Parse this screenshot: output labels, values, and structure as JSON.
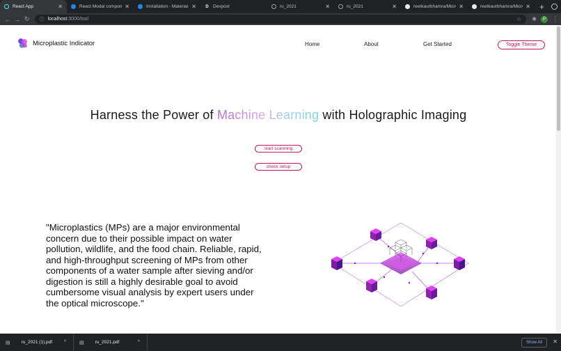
{
  "browser": {
    "tabs": [
      {
        "title": "React App",
        "active": true,
        "icon": "react-icon"
      },
      {
        "title": "React Modal component",
        "active": false,
        "icon": "mui-icon"
      },
      {
        "title": "Installation - Material-UI",
        "active": false,
        "icon": "mui-icon"
      },
      {
        "title": "Devpost",
        "active": false,
        "icon": "devpost-icon"
      },
      {
        "title": "ru_2021",
        "active": false,
        "icon": "globe-icon"
      },
      {
        "title": "ru_2021",
        "active": false,
        "icon": "globe-icon"
      },
      {
        "title": "reetkaurbhamra/Micropl",
        "active": false,
        "icon": "github-icon"
      },
      {
        "title": "reetkaurbhamra/Micropl",
        "active": false,
        "icon": "github-icon"
      }
    ],
    "url_host": "localhost",
    "url_path": ":3000/tool",
    "avatar_letter": "P"
  },
  "header": {
    "brand_name": "Microplastic Indicator",
    "nav": [
      "Home",
      "About",
      "Get Started"
    ],
    "toggle_label": "Toggle Theme"
  },
  "hero": {
    "before": "Harness the Power of ",
    "highlight": "Machine Learning",
    "after": " with Holographic Imaging"
  },
  "actions": {
    "scan_label": "start scanning",
    "setup_label": "check setup"
  },
  "quote": "\"Microplastics (MPs) are a major environmental concern due to their possible impact on water pollution, wildlife, and the food chain. Reliable, rapid, and high-throughput screening of MPs from other components of a water sample after sieving and/or digestion is still a highly desirable goal to avoid cumbersome visual analysis by expert users under the optical microscope.\"",
  "downloads": {
    "items": [
      "ru_2021 (1).pdf",
      "ru_2021.pdf"
    ],
    "show_all": "Show All"
  },
  "colors": {
    "accent": "#c2185b",
    "purple": "#9c27b0"
  }
}
